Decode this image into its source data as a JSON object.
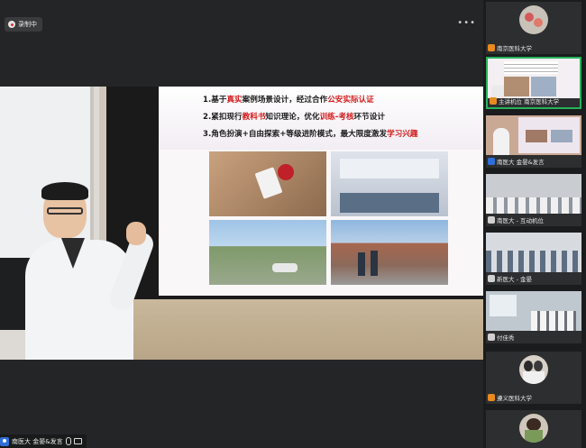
{
  "recording": {
    "label": "录制中"
  },
  "slide": {
    "lines": [
      {
        "prefix": "1.基于",
        "red1": "真实",
        "mid": "案例场景设计，经过合作",
        "red2": "公安实际认证",
        "suffix": ""
      },
      {
        "prefix": "2.紧扣现行",
        "red1": "教科书",
        "mid": "知识理论，优化",
        "red2": "训练-考核",
        "suffix": "环节设计"
      },
      {
        "prefix": "3.角色扮演+自由探索+等级进阶模式，最大限度激发",
        "red1": "",
        "mid": "",
        "red2": "学习兴趣",
        "suffix": ""
      }
    ]
  },
  "main_speaker": {
    "label": "南医大 金晏&发言"
  },
  "participants": [
    {
      "label": "南京医科大学",
      "badge": "orange",
      "thumb": "avatar"
    },
    {
      "label": "主讲机位 南京医科大学",
      "badge": "orange",
      "thumb": "slide",
      "active": true
    },
    {
      "label": "南医大 金晏&发言",
      "badge": "blue",
      "thumb": "slide2"
    },
    {
      "label": "南医大 - 互动机位",
      "badge": "gray",
      "thumb": "classroom"
    },
    {
      "label": "新医大 - 金晏",
      "badge": "gray",
      "thumb": "classroom2"
    },
    {
      "label": "付佳秀",
      "badge": "gray",
      "thumb": "classroom3"
    },
    {
      "label": "遵义医科大学",
      "badge": "orange",
      "thumb": "avatar2"
    },
    {
      "label": "",
      "badge": "",
      "thumb": "avatar3"
    }
  ],
  "colors": {
    "accent_green": "#26b35a",
    "highlight_red": "#d21a1a"
  }
}
